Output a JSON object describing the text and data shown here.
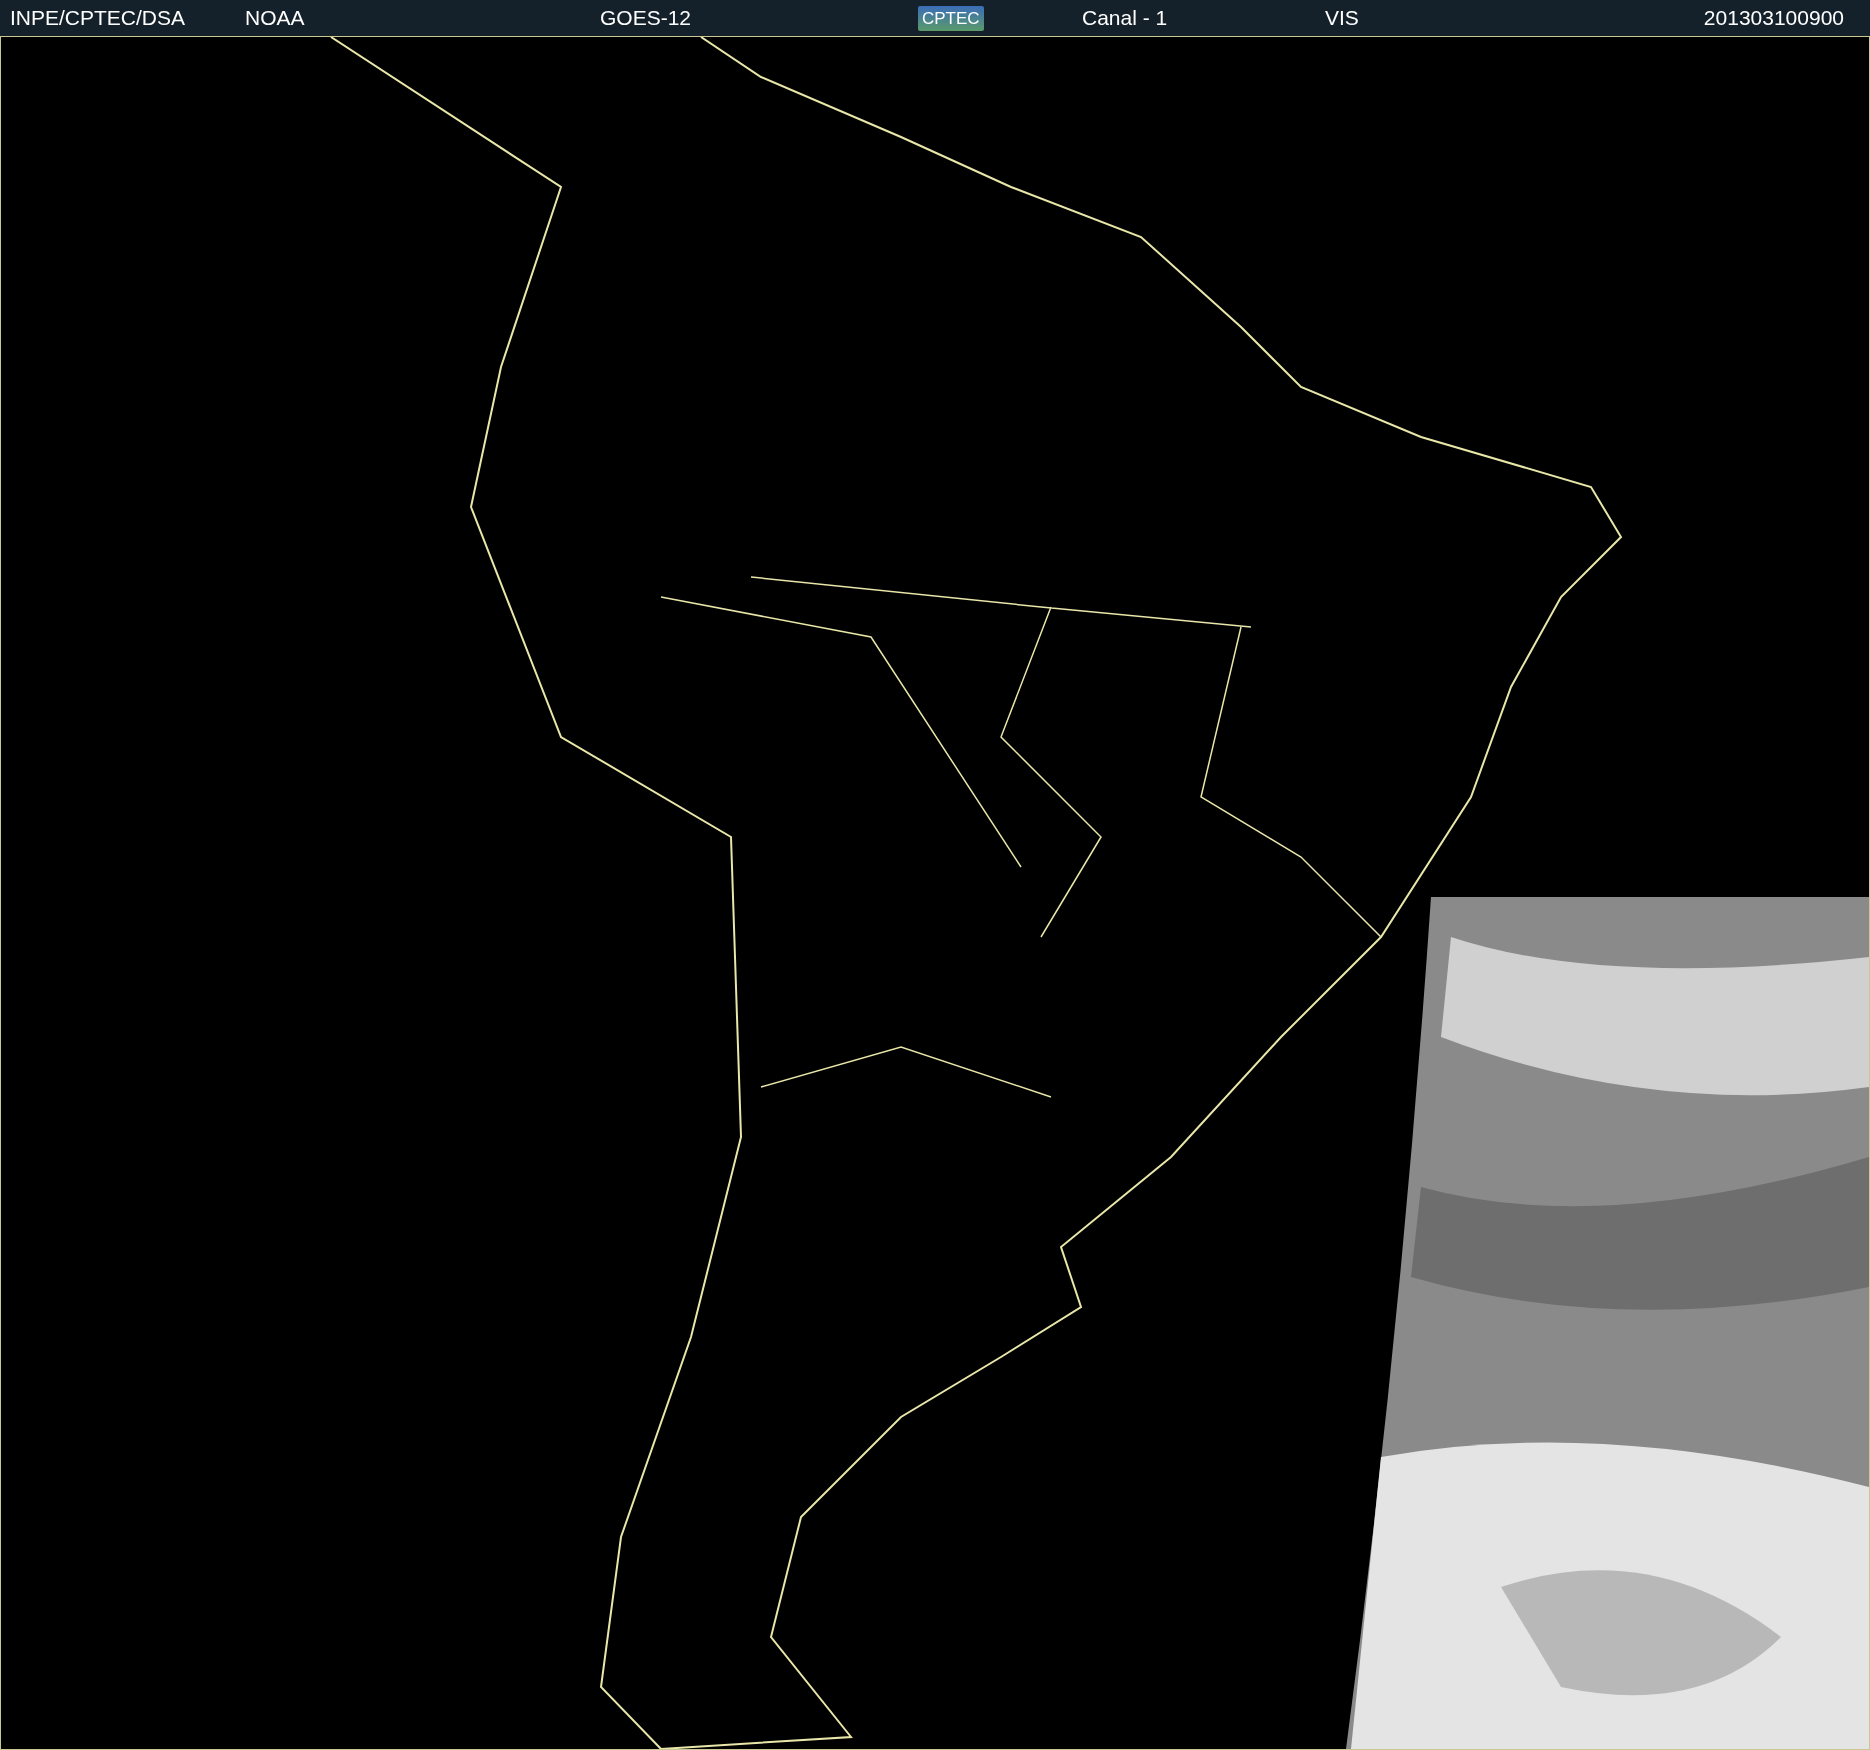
{
  "header": [
    {
      "kind": "text",
      "text": "INPE/CPTEC/DSA"
    },
    {
      "kind": "text",
      "text": "NOAA"
    },
    {
      "kind": "text",
      "text": "GOES-12"
    },
    {
      "kind": "logo",
      "text": "CPTEC"
    },
    {
      "kind": "text",
      "text": "Canal - 1"
    },
    {
      "kind": "text",
      "text": "VIS"
    },
    {
      "kind": "text",
      "text": "201303100900"
    }
  ]
}
